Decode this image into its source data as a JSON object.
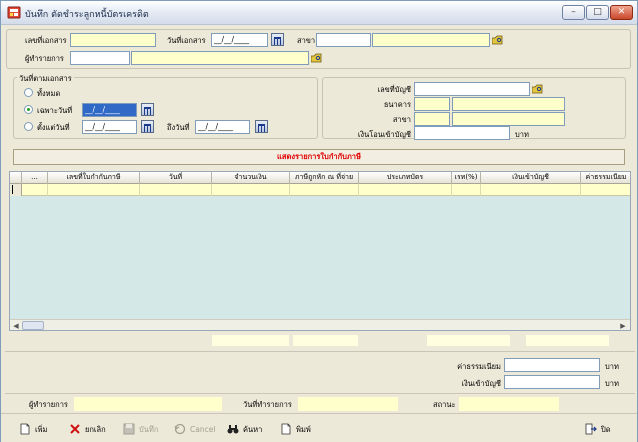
{
  "window": {
    "title": "บันทึก ตัดชำระลูกหนี้บัตรเครดิต",
    "minimize": "–",
    "maximize": "□",
    "close": "✕"
  },
  "header": {
    "doc_no_label": "เลขที่เอกสาร",
    "doc_no_value": "",
    "doc_date_label": "วันที่เอกสาร",
    "doc_date_value": "__/__/____",
    "branch_label": "สาขา",
    "branch_code": "",
    "branch_name": "",
    "recorder_label": "ผู้ทำรายการ",
    "recorder_code": "",
    "recorder_name": ""
  },
  "date_filter": {
    "title": "วันที่ตามเอกสาร",
    "all_label": "ทั้งหมด",
    "only_label": "เฉพาะวันที่",
    "only_value": "__/__/____",
    "from_label": "ตั้งแต่วันที่",
    "from_value": "__/__/____",
    "to_label": "ถึงวันที่",
    "to_value": "__/__/____"
  },
  "account": {
    "acct_no_label": "เลขที่บัญชี",
    "acct_no_value": "",
    "bank_label": "ธนาคาร",
    "bank_code": "",
    "bank_name": "",
    "branch_label": "สาขา",
    "branch_code": "",
    "branch_name": "",
    "transfer_label": "เงินโอนเข้าบัญชี",
    "transfer_value": "",
    "unit": "บาท"
  },
  "banner_text": "แสดงรายการใบกำกับภาษี",
  "grid": {
    "columns": [
      "...",
      "เลขที่ใบกำกับภาษี",
      "วันที่",
      "จำนวนเงิน",
      "ภาษีถูกหัก ณ ที่จ่าย",
      "ประเภทบัตร",
      "เรท(%)",
      "เงินเข้าบัญชี",
      "ค่าธรรมเนียม"
    ]
  },
  "summary": {
    "fee_label": "ค่าธรรมเนียม",
    "fee_value": "",
    "deposit_label": "เงินเข้าบัญชี",
    "deposit_value": "",
    "unit": "บาท"
  },
  "status": {
    "recorder_label": "ผู้ทำรายการ",
    "recorder_value": "",
    "record_date_label": "วันที่ทำรายการ",
    "record_date_value": "",
    "state_label": "สถานะ",
    "state_value": ""
  },
  "toolbar": {
    "add": "เพิ่ม",
    "cancel_th": "ยกเลิก",
    "save": "บันทึก",
    "cancel_en": "Cancel",
    "find": "ค้นหา",
    "print": "พิมพ์",
    "close": "ปิด"
  },
  "colors": {
    "banner_text": "#e00000",
    "grid_bg": "#d4e9e7",
    "required_field": "#ffffcc"
  }
}
